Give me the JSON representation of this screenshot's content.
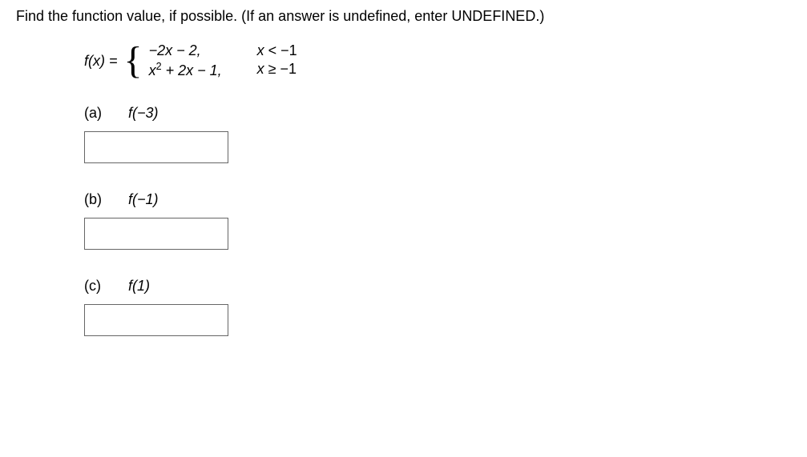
{
  "instruction": "Find the function value, if possible. (If an answer is undefined, enter UNDEFINED.)",
  "function": {
    "label_prefix": "f",
    "label_var": "x",
    "label_after": ") = ",
    "piece1": {
      "expr": "−2x − 2,",
      "cond_var": "x",
      "cond_op": " < ",
      "cond_val": "−1"
    },
    "piece2": {
      "expr_before_sup": "x",
      "expr_sup": "2",
      "expr_after_sup": " + 2x − 1,",
      "cond_var": "x",
      "cond_op": " ≥ ",
      "cond_val": "−1"
    }
  },
  "parts": {
    "a": {
      "label": "(a)",
      "func": "f",
      "arg": "(−3)"
    },
    "b": {
      "label": "(b)",
      "func": "f",
      "arg": "(−1)"
    },
    "c": {
      "label": "(c)",
      "func": "f",
      "arg": "(1)"
    }
  }
}
